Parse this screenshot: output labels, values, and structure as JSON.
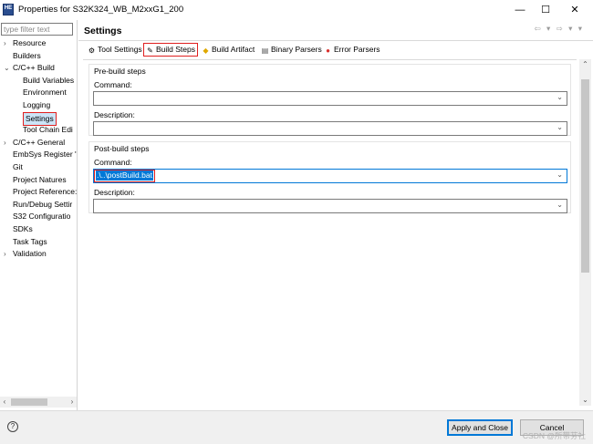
{
  "window": {
    "title": "Properties for S32K324_WB_M2xxG1_200",
    "icon_text": "HE",
    "controls": {
      "minimize": "—",
      "maximize": "☐",
      "close": "✕"
    }
  },
  "left": {
    "filter_placeholder": "type filter text",
    "tree": [
      {
        "label": "Resource",
        "level": 0,
        "chevron": "›"
      },
      {
        "label": "Builders",
        "level": 0,
        "chevron": ""
      },
      {
        "label": "C/C++ Build",
        "level": 0,
        "chevron": "⌄"
      },
      {
        "label": "Build Variables",
        "level": 1,
        "chevron": ""
      },
      {
        "label": "Environment",
        "level": 1,
        "chevron": ""
      },
      {
        "label": "Logging",
        "level": 1,
        "chevron": ""
      },
      {
        "label": "Settings",
        "level": 1,
        "chevron": "",
        "selected": true
      },
      {
        "label": "Tool Chain Edi",
        "level": 1,
        "chevron": ""
      },
      {
        "label": "C/C++ General",
        "level": 0,
        "chevron": "›"
      },
      {
        "label": "EmbSys Register '",
        "level": 0,
        "chevron": ""
      },
      {
        "label": "Git",
        "level": 0,
        "chevron": ""
      },
      {
        "label": "Project Natures",
        "level": 0,
        "chevron": ""
      },
      {
        "label": "Project Reference:",
        "level": 0,
        "chevron": ""
      },
      {
        "label": "Run/Debug Settir",
        "level": 0,
        "chevron": ""
      },
      {
        "label": "S32 Configuratio",
        "level": 0,
        "chevron": ""
      },
      {
        "label": "SDKs",
        "level": 0,
        "chevron": ""
      },
      {
        "label": "Task Tags",
        "level": 0,
        "chevron": ""
      },
      {
        "label": "Validation",
        "level": 0,
        "chevron": "›"
      }
    ]
  },
  "right": {
    "heading": "Settings",
    "nav_arrows": "⇦ ▾ ⇨ ▾ ▾",
    "tabs": [
      {
        "label": "Tool Settings",
        "icon": "⚙"
      },
      {
        "label": "Build Steps",
        "icon": "✎",
        "active": true
      },
      {
        "label": "Build Artifact",
        "icon": "◆"
      },
      {
        "label": "Binary Parsers",
        "icon": "▤"
      },
      {
        "label": "Error Parsers",
        "icon": "●"
      }
    ],
    "pre_build": {
      "title": "Pre-build steps",
      "command_label": "Command:",
      "command_value": "",
      "description_label": "Description:",
      "description_value": ""
    },
    "post_build": {
      "title": "Post-build steps",
      "command_label": "Command:",
      "command_value": ".\\..\\postBuild.bat",
      "description_label": "Description:",
      "description_value": ""
    }
  },
  "footer": {
    "help": "?",
    "apply_close": "Apply and Close",
    "cancel": "Cancel",
    "watermark": "CSDN @所带芬社"
  },
  "colors": {
    "accent": "#0078d7",
    "highlight": "#e02020"
  }
}
